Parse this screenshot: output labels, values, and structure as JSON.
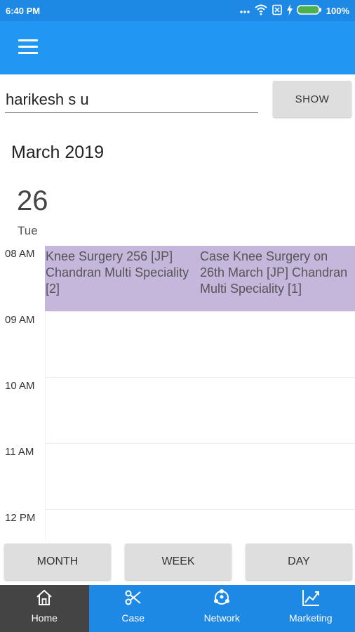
{
  "status_bar": {
    "time": "6:40 PM",
    "icons": [
      "more-dots-icon",
      "wifi-icon",
      "sim-icon",
      "charging-icon",
      "battery-icon"
    ],
    "battery": "100%"
  },
  "app_bar": {
    "color": "#2196f3"
  },
  "search": {
    "value": "harikesh s u",
    "button": "SHOW"
  },
  "calendar": {
    "month": "March 2019",
    "day_number": "26",
    "day_name": "Tue",
    "hours": [
      "08 AM",
      "09 AM",
      "10 AM",
      "11 AM",
      "12 PM"
    ],
    "events": [
      {
        "text": "Knee Surgery 256 [JP] Chandran Multi Speciality [2]",
        "color": "#c5b6dc"
      },
      {
        "text": "Case Knee Surgery on 26th March [JP] Chandran Multi Speciality [1]",
        "color": "#c5b6dc"
      }
    ]
  },
  "view_buttons": {
    "month": "MONTH",
    "week": "WEEK",
    "day": "DAY"
  },
  "bottom_nav": [
    {
      "label": "Home",
      "icon": "home-icon",
      "active": true
    },
    {
      "label": "Case",
      "icon": "scissors-icon",
      "active": false
    },
    {
      "label": "Network",
      "icon": "network-icon",
      "active": false
    },
    {
      "label": "Marketing",
      "icon": "trending-up-icon",
      "active": false
    }
  ]
}
